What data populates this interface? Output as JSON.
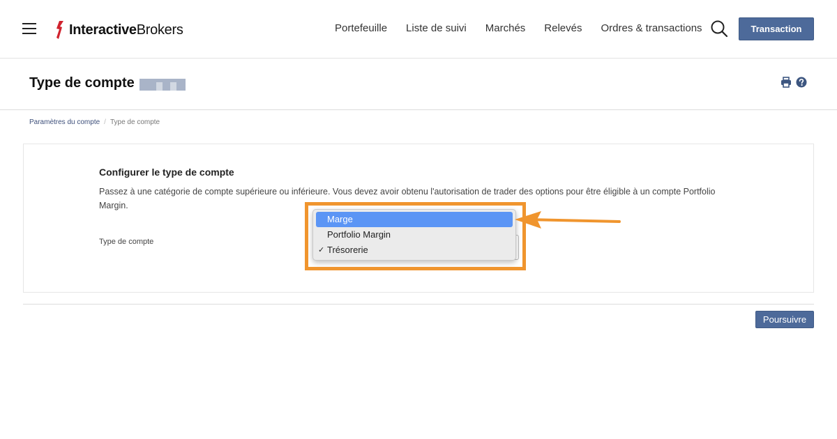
{
  "header": {
    "logo": {
      "part1": "Interactive",
      "part2": "Brokers",
      "brand_color": "#d0232e"
    },
    "nav": [
      "Portefeuille",
      "Liste de suivi",
      "Marchés",
      "Relevés",
      "Ordres & transactions"
    ],
    "trade_button": "Transaction",
    "icons": {
      "menu": "hamburger-menu-icon",
      "search": "search-icon"
    }
  },
  "page": {
    "title": "Type de compte",
    "icons": [
      "print-icon",
      "help-icon"
    ]
  },
  "breadcrumb": {
    "parent": "Paramètres du compte",
    "separator": "/",
    "current": "Type de compte"
  },
  "form": {
    "section_title": "Configurer le type de compte",
    "description": "Passez à une catégorie de compte supérieure ou inférieure. Vous devez avoir obtenu l'autorisation de trader des options pour être éligible à un compte Portfolio Margin.",
    "field_label": "Type de compte",
    "dropdown": {
      "options": [
        "Marge",
        "Portfolio Margin",
        "Trésorerie"
      ],
      "highlighted": "Marge",
      "checked": "Trésorerie",
      "check_mark": "✓"
    }
  },
  "actions": {
    "continue": "Poursuivre"
  },
  "colors": {
    "primary_button": "#4d6a9a",
    "annotation_orange": "#f0952e",
    "option_highlight": "#5b95f5"
  }
}
